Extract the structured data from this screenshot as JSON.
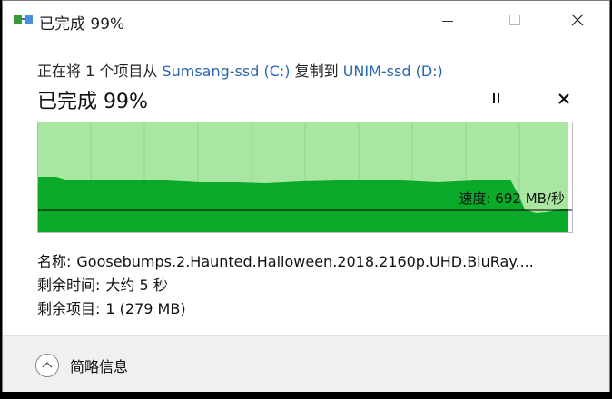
{
  "window": {
    "title": "已完成 99%",
    "icon": "copy-progress-icon"
  },
  "transfer": {
    "prefix": "正在将 1 个项目从 ",
    "source": "Sumsang-ssd (C:)",
    "middle": " 复制到 ",
    "destination": "UNIM-ssd (D:)"
  },
  "status": {
    "title": "已完成 99%",
    "progress_percent": 99
  },
  "graph": {
    "speed_label": "速度: 692 MB/秒",
    "colors": {
      "background": "#a9e6a1",
      "fill": "#0aa92a",
      "grid": "#8fd588",
      "line": "#000000"
    }
  },
  "details": {
    "name_key": "名称:",
    "name_value": "Goosebumps.2.Haunted.Halloween.2018.2160p.UHD.BluRay....",
    "time_key": "剩余时间:",
    "time_value": "大约 5 秒",
    "items_key": "剩余项目:",
    "items_value": "1 (279 MB)"
  },
  "footer": {
    "toggle_label": "简略信息"
  }
}
